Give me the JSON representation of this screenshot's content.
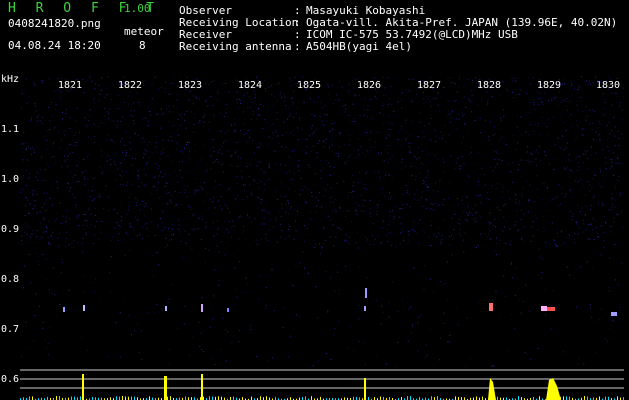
{
  "header": {
    "app_title": "H R O F F T",
    "app_version": "1.00",
    "file_name": "0408241820.png",
    "datetime": "04.08.24 18:20",
    "meteor_label": "meteor",
    "meteor_count": "8"
  },
  "info": [
    {
      "key": "Observer",
      "value": "Masayuki Kobayashi"
    },
    {
      "key": "Receiving Location",
      "value": "Ogata-vill. Akita-Pref. JAPAN (139.96E, 40.02N)"
    },
    {
      "key": "Receiver",
      "value": "ICOM IC-575 53.7492(@LCD)MHz USB"
    },
    {
      "key": "Receiving antenna",
      "value": "A504HB(yagi 4el)"
    }
  ],
  "colon": ":",
  "y_unit": "kHz",
  "y_ticks": [
    "1.1",
    "1.0",
    "0.9",
    "0.8",
    "0.7",
    "0.6"
  ],
  "minute_labels": [
    "1821",
    "1822",
    "1823",
    "1824",
    "1825",
    "1826",
    "1827",
    "1828",
    "1829",
    "1830"
  ],
  "colors": {
    "title": "#3fd13f",
    "background": "#000000",
    "noise": "#1a1a7a",
    "graph": "#ffff00",
    "graph_low": "#00e0ff"
  }
}
